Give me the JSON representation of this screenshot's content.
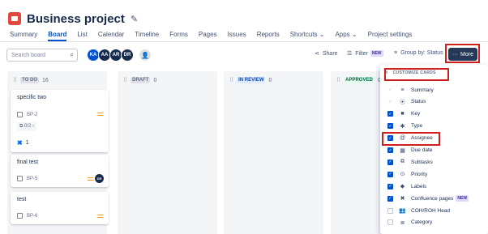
{
  "project": {
    "title": "Business project",
    "pin_icon": "pin-icon"
  },
  "nav": [
    "Summary",
    "Board",
    "List",
    "Calendar",
    "Timeline",
    "Forms",
    "Pages",
    "Issues",
    "Reports",
    "Shortcuts ⌄",
    "Apps ⌄",
    "Project settings"
  ],
  "nav_active": "Board",
  "search": {
    "placeholder": "Search board"
  },
  "avatars": [
    {
      "initials": "KA",
      "color": "#0052cc"
    },
    {
      "initials": "AA",
      "color": "#172b4d"
    },
    {
      "initials": "AR",
      "color": "#172b4d"
    },
    {
      "initials": "DR",
      "color": "#172b4d"
    }
  ],
  "toolbar": {
    "share": "Share",
    "filter": "Filter",
    "filter_badge": "NEW",
    "group_by": "Group by: Status",
    "more": "More"
  },
  "columns": [
    {
      "label": "TO DO",
      "count": "16",
      "label_bg": "#dfe1e6"
    },
    {
      "label": "DRAFT",
      "count": "0",
      "label_bg": "#dfe1e6"
    },
    {
      "label": "IN REVIEW",
      "count": "0",
      "label_bg": "#deebff"
    },
    {
      "label": "APPROVED",
      "count": "0",
      "label_bg": "#e3fcef"
    }
  ],
  "cards": [
    {
      "title": "specific two",
      "key": "BP-2",
      "subtasks": "0/2",
      "confluence": "1"
    },
    {
      "title": "final test",
      "key": "BP-5",
      "assignee": "DR"
    },
    {
      "title": "test",
      "key": "BP-6"
    }
  ],
  "customize": {
    "header": "CUSTOMIZE CARDS",
    "options": [
      {
        "label": "Summary",
        "icon": "≡",
        "state": "disabled"
      },
      {
        "label": "Status",
        "icon": "⦿",
        "state": "disabled"
      },
      {
        "label": "Key",
        "icon": "■",
        "state": "checked"
      },
      {
        "label": "Type",
        "icon": "✱",
        "state": "checked"
      },
      {
        "label": "Assignee",
        "icon": "@",
        "state": "checked"
      },
      {
        "label": "Due date",
        "icon": "▦",
        "state": "checked"
      },
      {
        "label": "Subtasks",
        "icon": "⧉",
        "state": "checked"
      },
      {
        "label": "Priority",
        "icon": "⊙",
        "state": "checked"
      },
      {
        "label": "Labels",
        "icon": "◆",
        "state": "checked"
      },
      {
        "label": "Confluence pages",
        "icon": "✖",
        "state": "checked",
        "badge": "NEW"
      },
      {
        "label": "COH/ROH Head",
        "icon": "👥",
        "state": "unchecked"
      },
      {
        "label": "Category",
        "icon": "≣",
        "state": "unchecked"
      }
    ]
  }
}
